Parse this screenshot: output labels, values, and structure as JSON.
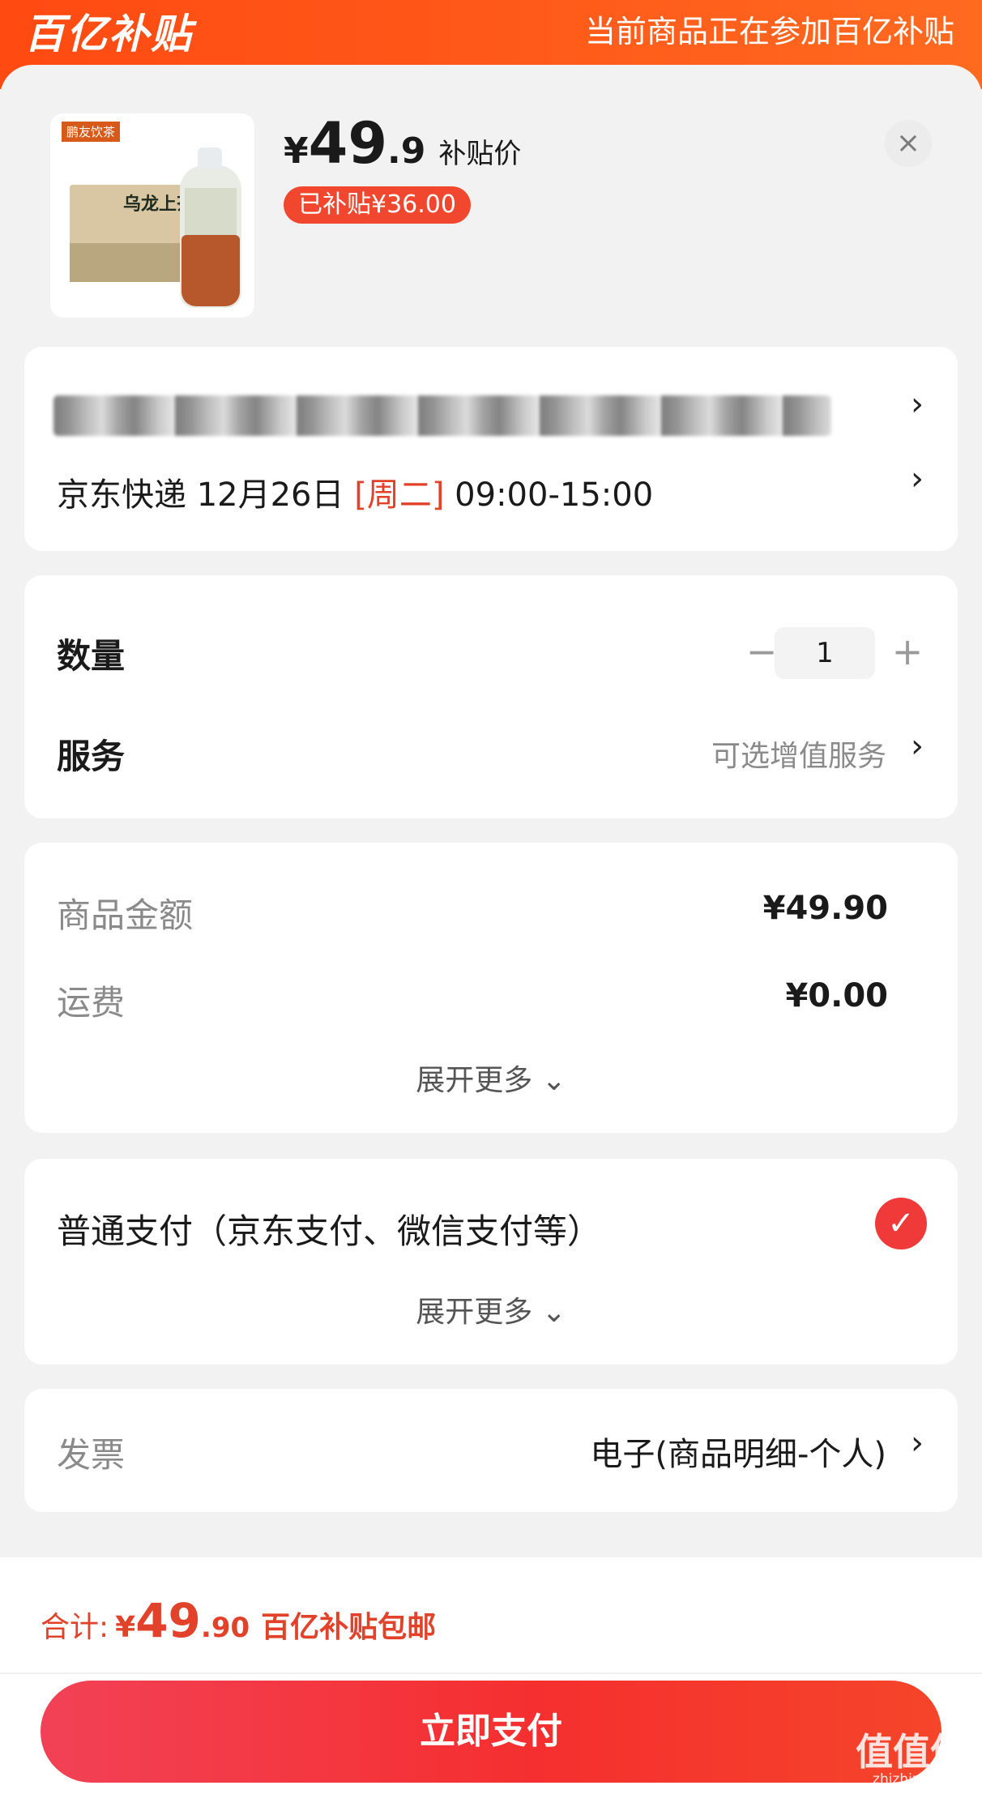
{
  "topbar": {
    "brand": "百亿补贴",
    "banner": "当前商品正在参加百亿补贴"
  },
  "product": {
    "thumb_tag": "鹏友饮茶",
    "thumb_title": "乌龙上茶",
    "currency": "¥",
    "price_int": "49",
    "price_dec": ".9",
    "price_label": "补贴价",
    "subsidy_badge": "已补贴¥36.00",
    "close": "×"
  },
  "delivery": {
    "prefix": "京东快递 12月26日 ",
    "weekday": "[周二]",
    "time": " 09:00-15:00",
    "chevron": "›"
  },
  "options": {
    "qty_label": "数量",
    "qty_minus": "−",
    "qty_value": "1",
    "qty_plus": "+",
    "service_label": "服务",
    "service_hint": "可选增值服务"
  },
  "amount": {
    "goods_label": "商品金额",
    "goods_value": "¥49.90",
    "shipping_label": "运费",
    "shipping_value": "¥0.00",
    "expand": "展开更多 ⌄"
  },
  "payment": {
    "method": "普通支付（京东支付、微信支付等）",
    "check": "✓",
    "expand": "展开更多 ⌄"
  },
  "invoice": {
    "label": "发票",
    "value": "电子(商品明细-个人)"
  },
  "footer": {
    "total_label": "合计:",
    "total_yen": "¥",
    "total_int": "49",
    "total_dec": ".90",
    "total_note": "百亿补贴包邮",
    "pay_button": "立即支付"
  },
  "watermark": {
    "main": "值值值",
    "sub": "zhizhizhi.com"
  },
  "colors": {
    "brand_orange": "#ff5a1a",
    "accent_red": "#e2422a",
    "pay_button": "#f52f2f"
  }
}
